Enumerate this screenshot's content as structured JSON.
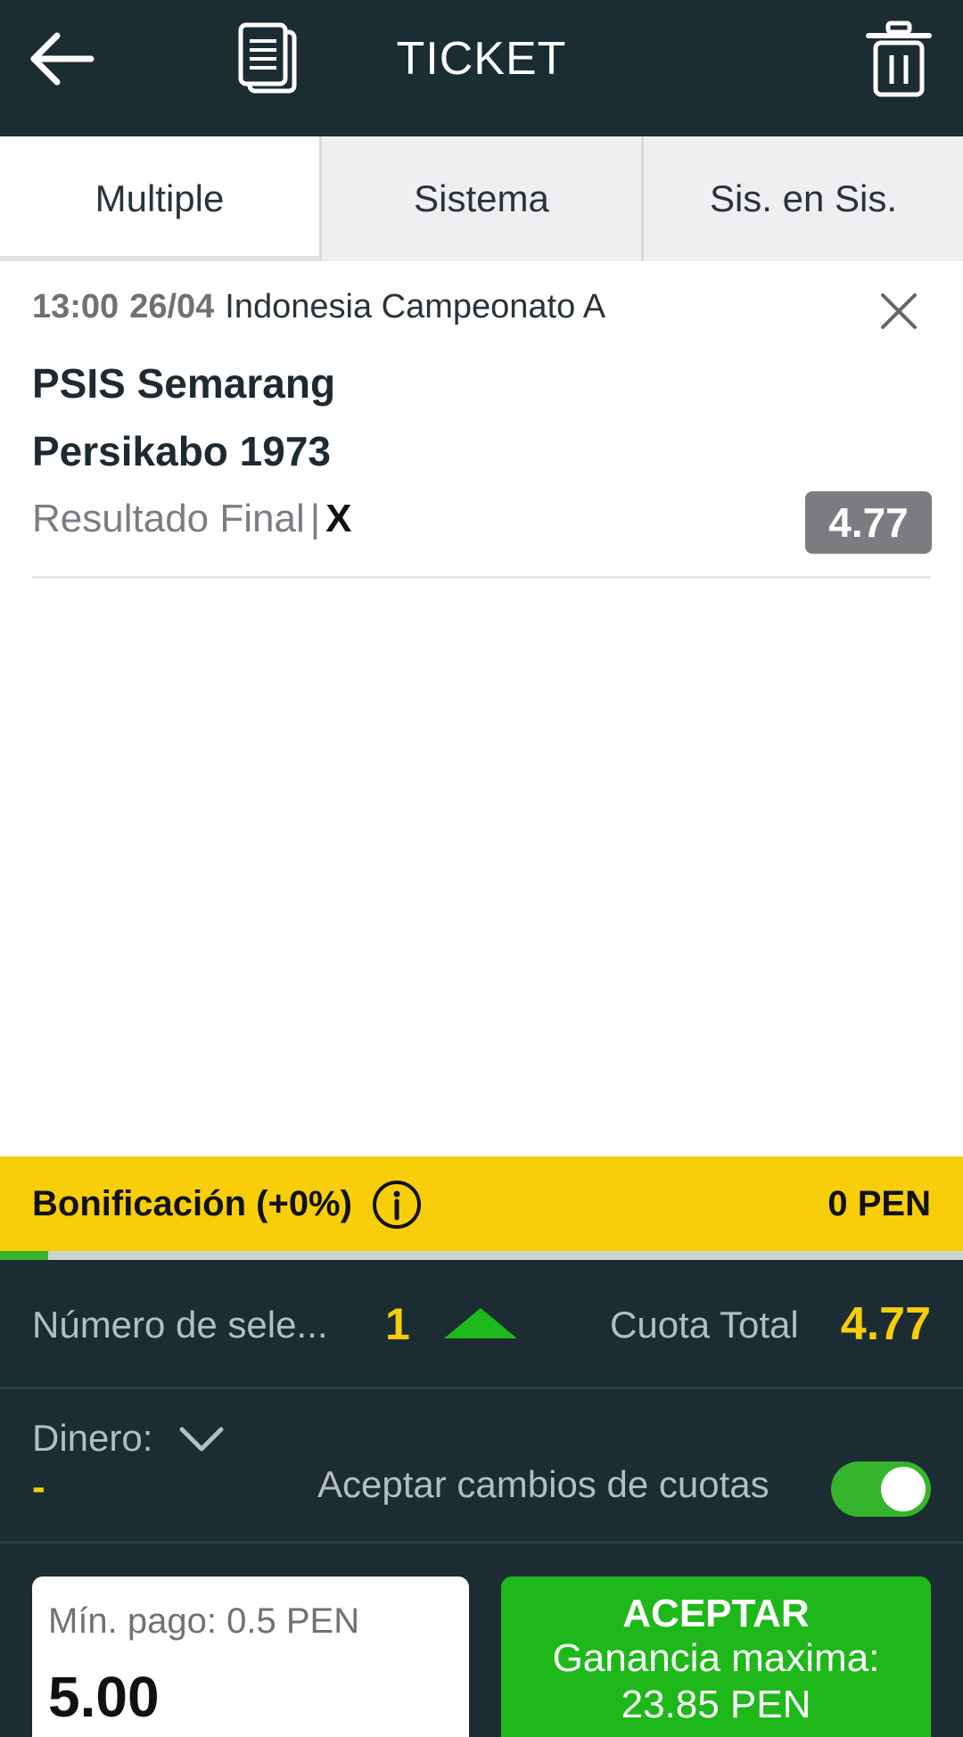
{
  "header": {
    "title": "TICKET",
    "icons": {
      "back": "back-arrow-icon",
      "betslip": "document-icon",
      "delete": "trash-icon"
    }
  },
  "tabs": [
    {
      "label": "Multiple",
      "active": true
    },
    {
      "label": "Sistema",
      "active": false
    },
    {
      "label": "Sis. en Sis.",
      "active": false
    }
  ],
  "bet": {
    "time": "13:00",
    "date": "26/04",
    "league": "Indonesia Campeonato A",
    "team_home": "PSIS Semarang",
    "team_away": "Persikabo 1973",
    "market": "Resultado Final",
    "separator": "|",
    "pick": "X",
    "odds": "4.77"
  },
  "bonus": {
    "label": "Bonificación (+0%)",
    "amount": "0 PEN",
    "progress_percent": 5
  },
  "summary": {
    "selections_label": "Número de sele...",
    "selections_count": "1",
    "total_odds_label": "Cuota Total",
    "total_odds_value": "4.77",
    "money_label": "Dinero:",
    "money_value": "-",
    "accept_changes_label": "Aceptar cambios de cuotas",
    "accept_changes_on": true
  },
  "stake": {
    "min_label": "Mín. pago: 0.5 PEN",
    "value": "5.00"
  },
  "accept_button": {
    "title": "ACEPTAR",
    "gain_label": "Ganancia maxima:",
    "gain_value": "23.85 PEN"
  },
  "colors": {
    "header_bg": "#1b2c33",
    "accent_yellow": "#f8cd0a",
    "accent_green": "#1fb81a",
    "odds_badge": "#7b7c80"
  }
}
